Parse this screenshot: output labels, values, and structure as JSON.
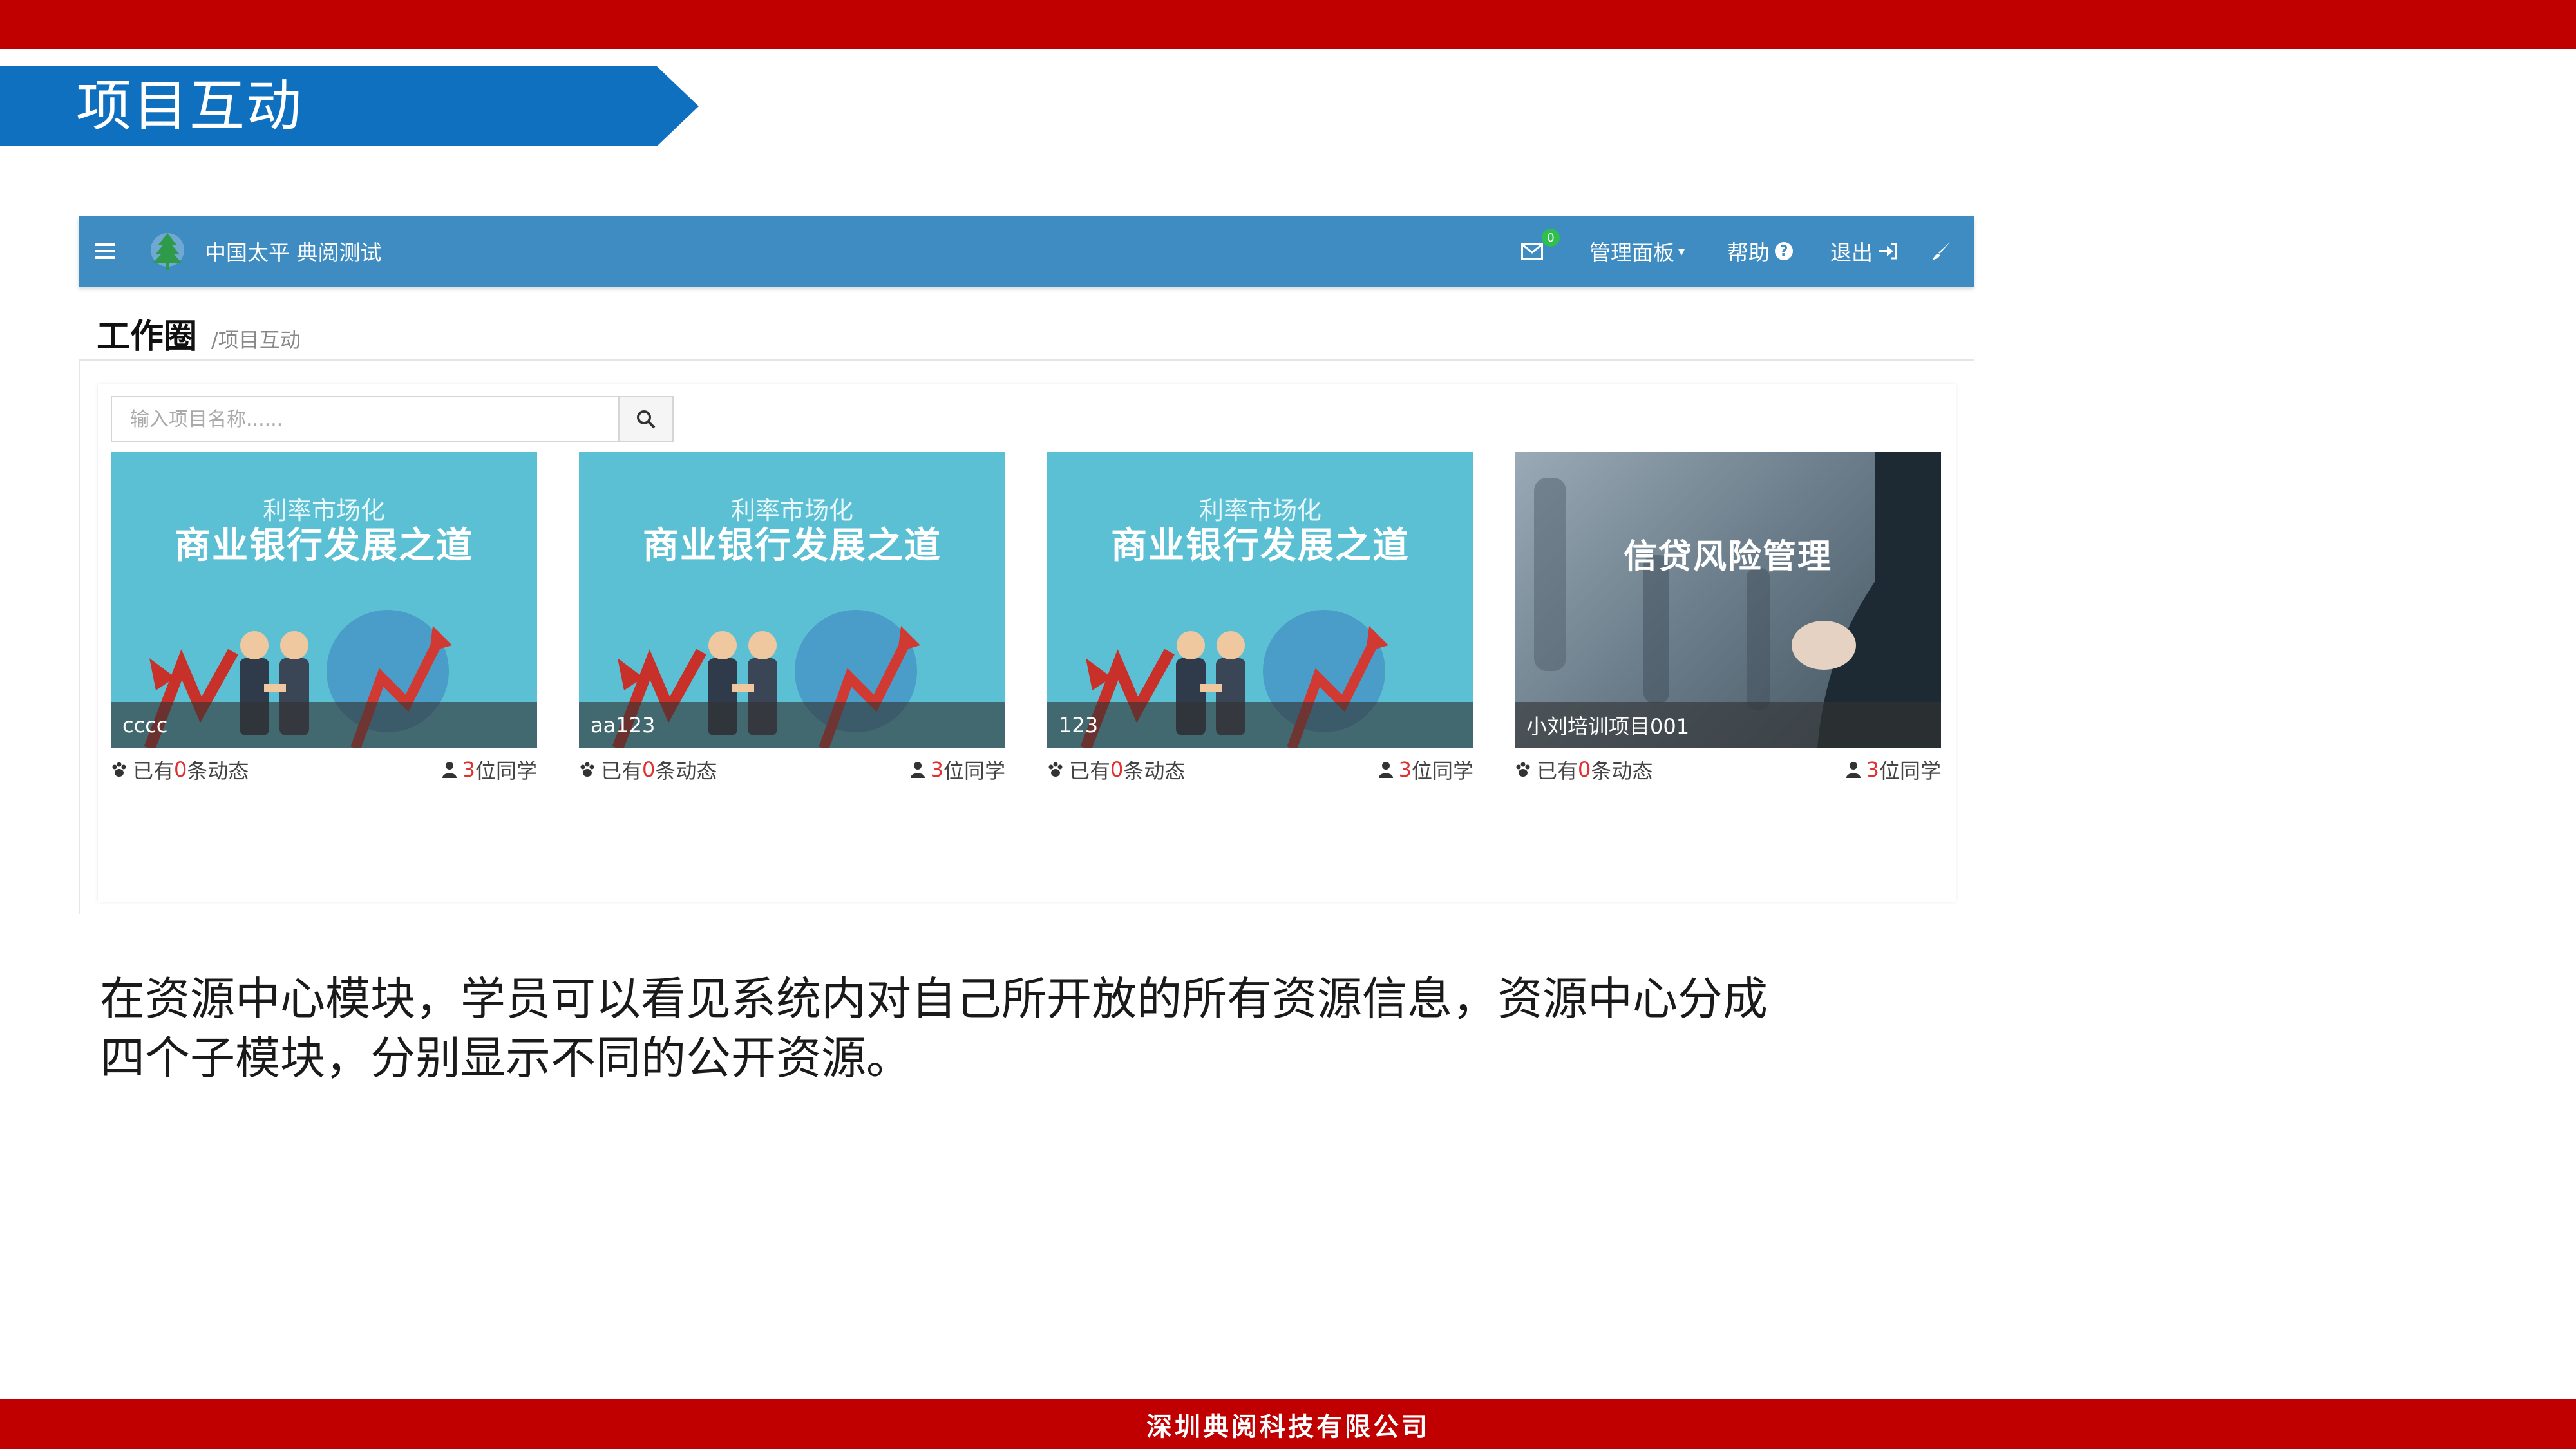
{
  "slide": {
    "title": "项目互动",
    "body": "在资源中心模块，学员可以看见系统内对自己所开放的所有资源信息，资源中心分成四个子模块，分别显示不同的公开资源。",
    "footer": "深圳典阅科技有限公司"
  },
  "colors": {
    "top_band": "#c00000",
    "title_banner": "#0f70c0",
    "navbar": "#3f8cc2",
    "accent_red": "#e03030",
    "badge_green": "#2fbf4d"
  },
  "app": {
    "navbar": {
      "menu_icon": "hamburger-icon",
      "logo_icon": "tree-logo-icon",
      "brand": "中国太平 典阅测试",
      "mail_icon": "envelope-icon",
      "mail_badge": "0",
      "manage_label": "管理面板",
      "help_label": "帮助",
      "logout_label": "退出",
      "brush_icon": "brush-icon"
    },
    "page_header": {
      "title": "工作圈",
      "breadcrumb": "/项目互动"
    },
    "search": {
      "placeholder": "输入项目名称......",
      "icon": "search-icon"
    },
    "cards": [
      {
        "sub": "利率市场化",
        "main": "商业银行发展之道",
        "name": "cccc",
        "activity_prefix": "已有",
        "activity_count": "0",
        "activity_suffix": "条动态",
        "members_count": "3",
        "members_suffix": "位同学"
      },
      {
        "sub": "利率市场化",
        "main": "商业银行发展之道",
        "name": "aa123",
        "activity_prefix": "已有",
        "activity_count": "0",
        "activity_suffix": "条动态",
        "members_count": "3",
        "members_suffix": "位同学"
      },
      {
        "sub": "利率市场化",
        "main": "商业银行发展之道",
        "name": "123",
        "activity_prefix": "已有",
        "activity_count": "0",
        "activity_suffix": "条动态",
        "members_count": "3",
        "members_suffix": "位同学"
      },
      {
        "sub": "",
        "main": "信贷风险管理",
        "name": "小刘培训项目001",
        "activity_prefix": "已有",
        "activity_count": "0",
        "activity_suffix": "条动态",
        "members_count": "3",
        "members_suffix": "位同学"
      }
    ]
  }
}
